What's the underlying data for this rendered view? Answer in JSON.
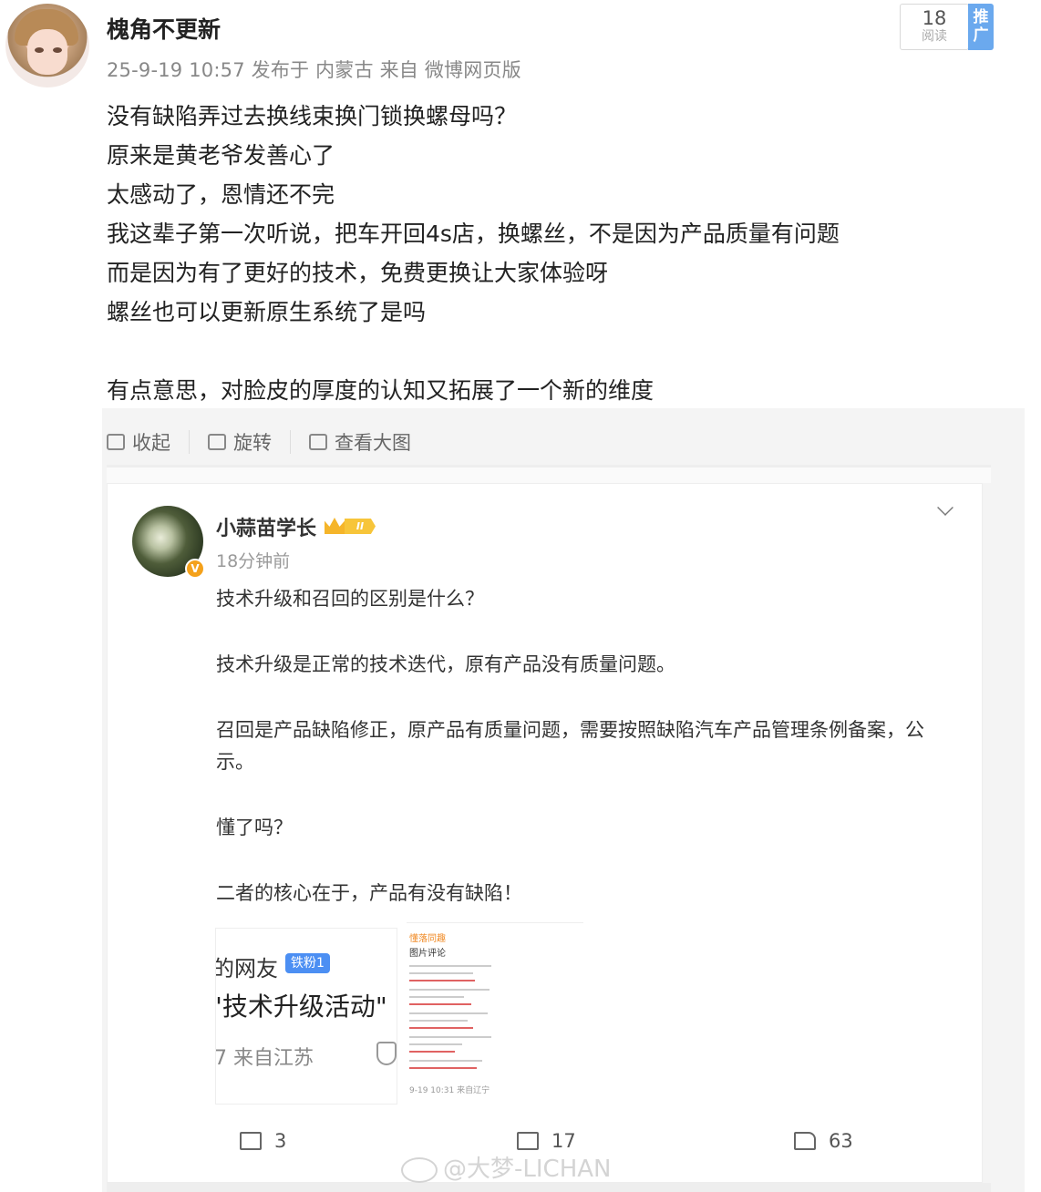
{
  "post": {
    "author": "槐角不更新",
    "meta": "25-9-19 10:57 发布于 内蒙古 来自 微博网页版",
    "reads_count": "18",
    "reads_label": "阅读",
    "promote_label": "推广",
    "lines": [
      "没有缺陷弄过去换线束换门锁换螺母吗？",
      "原来是黄老爷发善心了",
      "太感动了，恩情还不完",
      "我这辈子第一次听说，把车开回4s店，换螺丝，不是因为产品质量有问题",
      "而是因为有了更好的技术，免费更换让大家体验呀",
      "螺丝也可以更新原生系统了是吗",
      "",
      "有点意思，对脸皮的厚度的认知又拓展了一个新的维度"
    ]
  },
  "image_toolbar": {
    "collapse": "收起",
    "rotate": "旋转",
    "view_large": "查看大图"
  },
  "embedded": {
    "name": "小蒜苗学长",
    "level": "II",
    "time": "18分钟前",
    "paragraphs": [
      "技术升级和召回的区别是什么？",
      "技术升级是正常的技术迭代，原有产品没有质量问题。",
      "召回是产品缺陷修正，原产品有质量问题，需要按照缺陷汽车产品管理条例备案，公示。",
      "懂了吗？",
      "二者的核心在于，产品有没有缺陷！"
    ],
    "thumb1": {
      "line1": "的网友",
      "fan_badge": "铁粉1",
      "line2": "\"技术升级活动\"",
      "line3": "7 来自江苏"
    },
    "thumb2": {
      "header": "懂落同趣",
      "sub": "图片评论",
      "footer": "9-19 10:31 来自辽宁"
    },
    "actions": {
      "share": "3",
      "comment": "17",
      "like": "63"
    }
  },
  "watermark": "@大梦-LICHAN"
}
